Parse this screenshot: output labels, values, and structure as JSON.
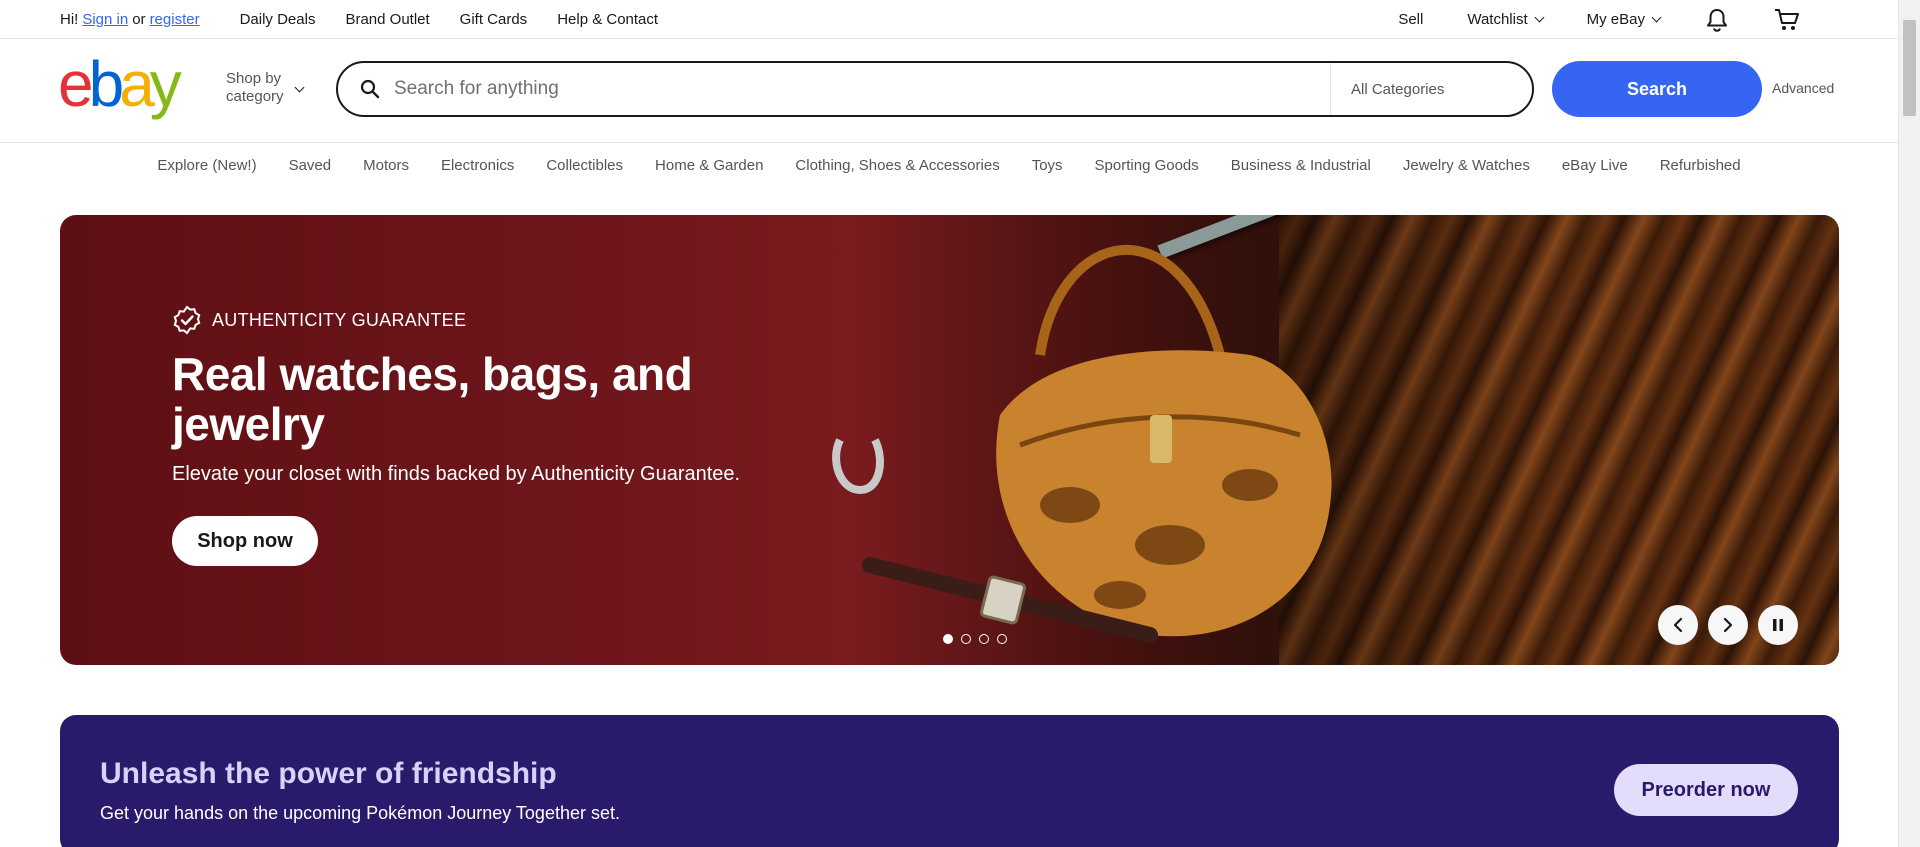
{
  "topbar": {
    "greeting_prefix": "Hi!",
    "sign_in": "Sign in",
    "or": "or",
    "register": "register",
    "links": [
      "Daily Deals",
      "Brand Outlet",
      "Gift Cards",
      "Help & Contact"
    ],
    "sell": "Sell",
    "watchlist": "Watchlist",
    "my_ebay": "My eBay"
  },
  "header": {
    "logo": [
      "e",
      "b",
      "a",
      "y"
    ],
    "shop_by_line1": "Shop by",
    "shop_by_line2": "category",
    "search_placeholder": "Search for anything",
    "category_select": "All Categories",
    "search_button": "Search",
    "advanced": "Advanced"
  },
  "categories": [
    "Explore (New!)",
    "Saved",
    "Motors",
    "Electronics",
    "Collectibles",
    "Home & Garden",
    "Clothing, Shoes & Accessories",
    "Toys",
    "Sporting Goods",
    "Business & Industrial",
    "Jewelry & Watches",
    "eBay Live",
    "Refurbished"
  ],
  "hero": {
    "tag": "AUTHENTICITY GUARANTEE",
    "title": "Real watches, bags, and jewelry",
    "subtitle": "Elevate your closet with finds backed by Authenticity Guarantee.",
    "cta": "Shop now",
    "slide_count": 4,
    "active_slide": 1
  },
  "promo": {
    "title": "Unleash the power of friendship",
    "subtitle": "Get your hands on the upcoming Pokémon Journey Together set.",
    "cta": "Preorder now"
  },
  "colors": {
    "accent": "#3665f3",
    "logo_e": "#e53238",
    "logo_b": "#0064d2",
    "logo_a": "#f5af02",
    "logo_y": "#86b817",
    "promo_bg": "#2a1a6b"
  }
}
